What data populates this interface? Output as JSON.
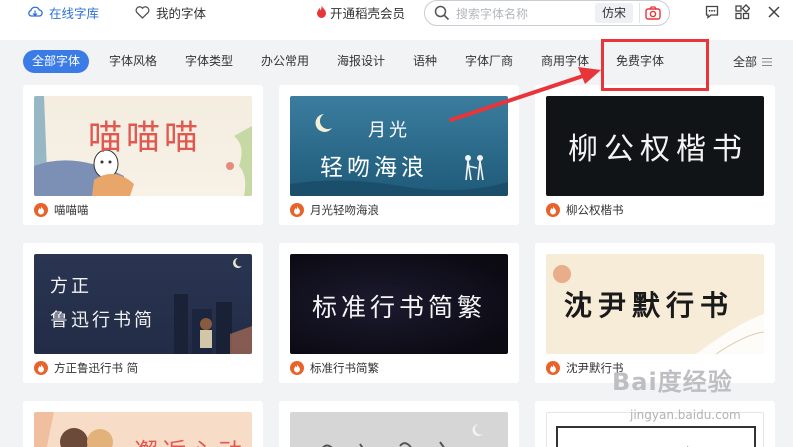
{
  "topbar": {
    "online_library": "在线字库",
    "my_fonts": "我的字体",
    "vip": "开通稻壳会员",
    "search_placeholder": "搜索字体名称",
    "imitate": "仿宋"
  },
  "tabs": {
    "items": [
      "全部字体",
      "字体风格",
      "字体类型",
      "办公常用",
      "海报设计",
      "语种",
      "字体厂商",
      "商用字体",
      "免费字体"
    ],
    "all_label": "全部"
  },
  "fonts": [
    {
      "name": "喵喵喵",
      "preview": "喵喵喵"
    },
    {
      "name": "月光轻吻海浪",
      "preview_line1": "月光",
      "preview_line2": "轻吻海浪"
    },
    {
      "name": "柳公权楷书",
      "preview": "柳公权楷书"
    },
    {
      "name": "方正鲁迅行书 简",
      "preview_line1": "方正",
      "preview_line2": "鲁迅行书简"
    },
    {
      "name": "标准行书简繁",
      "preview": "标准行书简繁"
    },
    {
      "name": "沈尹默行书",
      "preview": "沈尹默行书"
    }
  ],
  "row3": {
    "preview1": "邂逅心动"
  },
  "watermark": {
    "logo": "Bai度经验",
    "url": "jingyan.baidu.com"
  },
  "colors": {
    "accent": "#3a7be6",
    "annotation": "#e8353a",
    "badge": "#e8622a"
  }
}
